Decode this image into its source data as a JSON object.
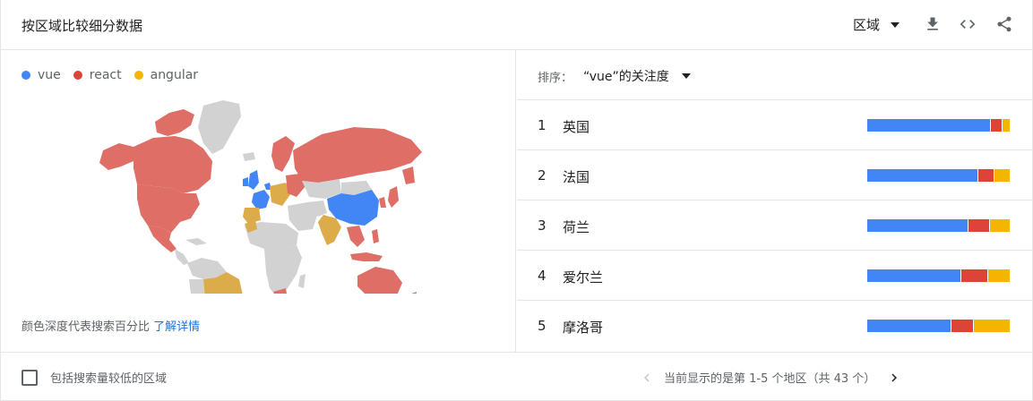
{
  "header": {
    "title": "按区域比较细分数据",
    "region_label": "区域",
    "icons": [
      "download-icon",
      "embed-code-icon",
      "share-icon"
    ]
  },
  "legend": [
    {
      "label": "vue",
      "color": "#4285f4"
    },
    {
      "label": "react",
      "color": "#db4437"
    },
    {
      "label": "angular",
      "color": "#f4b400"
    }
  ],
  "map": {
    "colors": {
      "vue": "#4285f4",
      "react": "#de6e66",
      "angular": "#dcab4a",
      "none": "#d2d2d2"
    }
  },
  "footnote": {
    "text": "颜色深度代表搜索百分比",
    "link": "了解详情"
  },
  "sort": {
    "label": "排序：",
    "value": "“vue”的关注度"
  },
  "rows": [
    {
      "rank": "1",
      "name": "英国",
      "vue": 87,
      "react": 8,
      "angular": 5
    },
    {
      "rank": "2",
      "name": "法国",
      "vue": 78,
      "react": 11,
      "angular": 11
    },
    {
      "rank": "3",
      "name": "荷兰",
      "vue": 71,
      "react": 15,
      "angular": 14
    },
    {
      "rank": "4",
      "name": "爱尔兰",
      "vue": 66,
      "react": 19,
      "angular": 15
    },
    {
      "rank": "5",
      "name": "摩洛哥",
      "vue": 59,
      "react": 16,
      "angular": 25
    }
  ],
  "footer": {
    "checkbox_label": "包括搜索量较低的区域",
    "pager_text": "当前显示的是第 1-5 个地区（共 43 个）"
  }
}
